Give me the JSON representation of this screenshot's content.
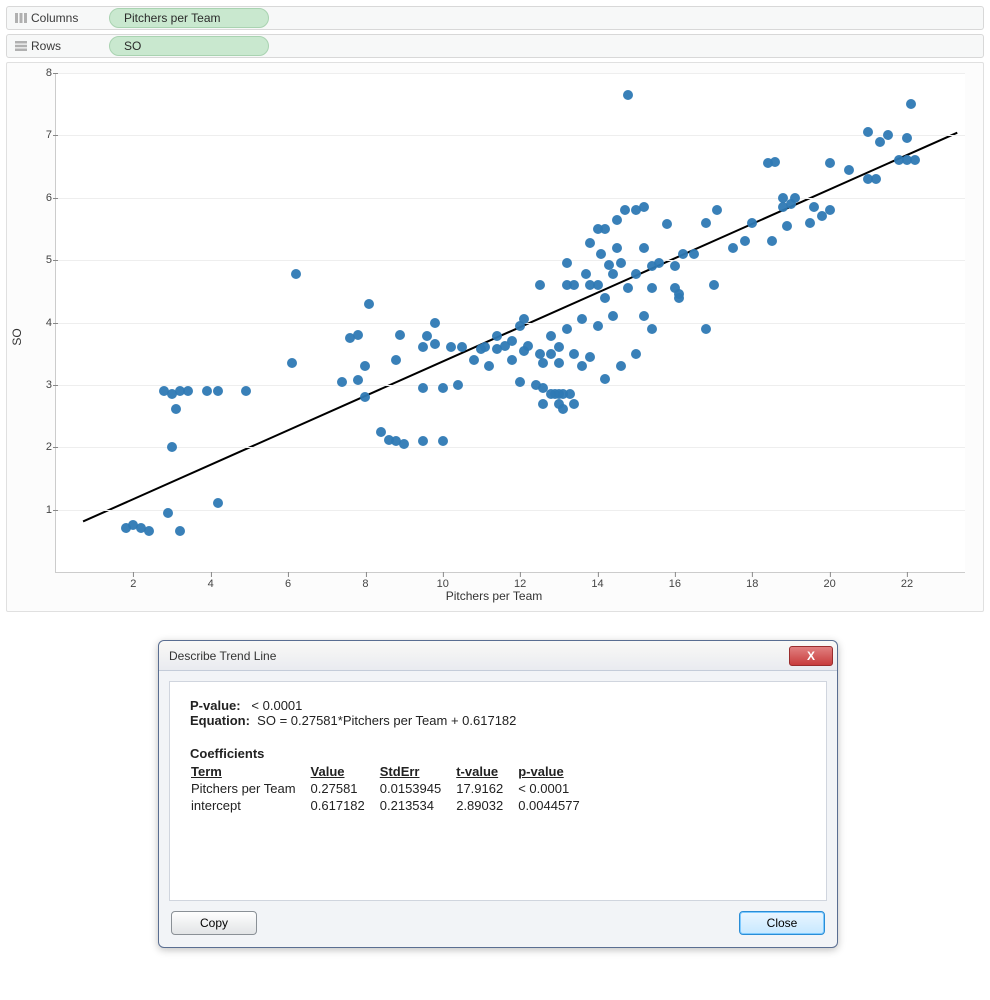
{
  "shelves": {
    "columns_label": "Columns",
    "rows_label": "Rows",
    "columns_pill": "Pitchers per Team",
    "rows_pill": "SO"
  },
  "chart_data": {
    "type": "scatter",
    "xlabel": "Pitchers per Team",
    "ylabel": "SO",
    "xlim": [
      0,
      23.5
    ],
    "ylim": [
      0,
      8
    ],
    "xticks": [
      2,
      4,
      6,
      8,
      10,
      12,
      14,
      16,
      18,
      20,
      22
    ],
    "yticks": [
      1,
      2,
      3,
      4,
      5,
      6,
      7,
      8
    ],
    "trend": {
      "slope": 0.27581,
      "intercept": 0.617182,
      "x0": 0.7,
      "x1": 23.3
    },
    "points": [
      [
        1.8,
        0.7
      ],
      [
        2.0,
        0.75
      ],
      [
        2.2,
        0.7
      ],
      [
        2.4,
        0.65
      ],
      [
        2.9,
        0.95
      ],
      [
        3.2,
        0.65
      ],
      [
        2.8,
        2.9
      ],
      [
        3.0,
        2.85
      ],
      [
        3.1,
        2.62
      ],
      [
        3.0,
        2.0
      ],
      [
        3.2,
        2.9
      ],
      [
        3.4,
        2.9
      ],
      [
        3.9,
        2.9
      ],
      [
        4.2,
        2.9
      ],
      [
        4.9,
        2.9
      ],
      [
        4.2,
        1.1
      ],
      [
        6.1,
        3.35
      ],
      [
        6.2,
        4.78
      ],
      [
        7.4,
        3.05
      ],
      [
        7.6,
        3.75
      ],
      [
        7.8,
        3.8
      ],
      [
        7.8,
        3.08
      ],
      [
        8.0,
        2.8
      ],
      [
        8.0,
        3.3
      ],
      [
        8.1,
        4.3
      ],
      [
        8.4,
        2.25
      ],
      [
        8.6,
        2.12
      ],
      [
        8.8,
        2.1
      ],
      [
        8.8,
        3.4
      ],
      [
        8.9,
        3.8
      ],
      [
        9.0,
        2.06
      ],
      [
        9.5,
        2.1
      ],
      [
        9.5,
        2.95
      ],
      [
        9.5,
        3.6
      ],
      [
        9.6,
        3.78
      ],
      [
        9.8,
        3.65
      ],
      [
        9.8,
        4.0
      ],
      [
        10.0,
        2.1
      ],
      [
        10.0,
        2.95
      ],
      [
        10.2,
        3.6
      ],
      [
        10.4,
        3.0
      ],
      [
        10.5,
        3.6
      ],
      [
        10.8,
        3.4
      ],
      [
        11.0,
        3.58
      ],
      [
        11.1,
        3.6
      ],
      [
        11.2,
        3.3
      ],
      [
        11.4,
        3.58
      ],
      [
        11.4,
        3.78
      ],
      [
        11.6,
        3.62
      ],
      [
        11.8,
        3.7
      ],
      [
        11.8,
        3.4
      ],
      [
        12.0,
        3.95
      ],
      [
        12.0,
        3.05
      ],
      [
        12.1,
        3.55
      ],
      [
        12.1,
        4.05
      ],
      [
        12.2,
        3.62
      ],
      [
        12.4,
        3.0
      ],
      [
        12.5,
        3.5
      ],
      [
        12.5,
        4.6
      ],
      [
        12.6,
        2.95
      ],
      [
        12.6,
        3.35
      ],
      [
        12.6,
        2.7
      ],
      [
        12.8,
        2.85
      ],
      [
        12.8,
        3.5
      ],
      [
        12.8,
        3.78
      ],
      [
        12.9,
        2.85
      ],
      [
        13.0,
        2.7
      ],
      [
        13.0,
        3.35
      ],
      [
        13.0,
        3.6
      ],
      [
        13.0,
        2.85
      ],
      [
        13.1,
        2.85
      ],
      [
        13.1,
        2.62
      ],
      [
        13.2,
        3.9
      ],
      [
        13.2,
        4.6
      ],
      [
        13.2,
        4.95
      ],
      [
        13.3,
        2.85
      ],
      [
        13.4,
        3.5
      ],
      [
        13.4,
        4.6
      ],
      [
        13.4,
        2.7
      ],
      [
        13.6,
        3.3
      ],
      [
        13.6,
        4.05
      ],
      [
        13.7,
        4.78
      ],
      [
        13.8,
        3.45
      ],
      [
        13.8,
        4.6
      ],
      [
        13.8,
        5.28
      ],
      [
        14.0,
        3.95
      ],
      [
        14.0,
        4.6
      ],
      [
        14.0,
        5.5
      ],
      [
        14.1,
        5.1
      ],
      [
        14.2,
        3.1
      ],
      [
        14.2,
        4.4
      ],
      [
        14.2,
        5.5
      ],
      [
        14.3,
        4.92
      ],
      [
        14.4,
        4.1
      ],
      [
        14.4,
        4.78
      ],
      [
        14.5,
        5.2
      ],
      [
        14.5,
        5.65
      ],
      [
        14.6,
        3.3
      ],
      [
        14.6,
        4.95
      ],
      [
        14.7,
        5.8
      ],
      [
        14.8,
        4.55
      ],
      [
        14.8,
        7.65
      ],
      [
        15.0,
        4.78
      ],
      [
        15.0,
        5.8
      ],
      [
        15.0,
        3.5
      ],
      [
        15.2,
        4.1
      ],
      [
        15.2,
        5.2
      ],
      [
        15.2,
        5.85
      ],
      [
        15.4,
        3.9
      ],
      [
        15.4,
        4.9
      ],
      [
        15.4,
        4.55
      ],
      [
        15.6,
        4.95
      ],
      [
        15.8,
        5.58
      ],
      [
        16.0,
        4.9
      ],
      [
        16.0,
        4.55
      ],
      [
        16.1,
        4.45
      ],
      [
        16.1,
        4.4
      ],
      [
        16.2,
        5.1
      ],
      [
        16.5,
        5.1
      ],
      [
        16.8,
        5.6
      ],
      [
        16.8,
        3.9
      ],
      [
        17.0,
        4.6
      ],
      [
        17.1,
        5.8
      ],
      [
        17.5,
        5.2
      ],
      [
        17.8,
        5.3
      ],
      [
        18.0,
        5.6
      ],
      [
        18.4,
        6.55
      ],
      [
        18.5,
        5.3
      ],
      [
        18.6,
        6.58
      ],
      [
        18.8,
        5.85
      ],
      [
        18.8,
        6.0
      ],
      [
        18.9,
        5.55
      ],
      [
        19.0,
        5.9
      ],
      [
        19.1,
        6.0
      ],
      [
        19.5,
        5.6
      ],
      [
        19.6,
        5.85
      ],
      [
        19.8,
        5.7
      ],
      [
        20.0,
        6.55
      ],
      [
        20.0,
        5.8
      ],
      [
        20.5,
        6.45
      ],
      [
        21.0,
        7.05
      ],
      [
        21.0,
        6.3
      ],
      [
        21.2,
        6.3
      ],
      [
        21.3,
        6.9
      ],
      [
        21.5,
        7.0
      ],
      [
        21.8,
        6.6
      ],
      [
        22.0,
        6.95
      ],
      [
        22.0,
        6.6
      ],
      [
        22.1,
        7.5
      ],
      [
        22.2,
        6.6
      ]
    ]
  },
  "dialog": {
    "title": "Describe Trend Line",
    "pvalue_label": "P-value:",
    "pvalue_value": "< 0.0001",
    "equation_label": "Equation:",
    "equation_value": "SO = 0.27581*Pitchers per Team + 0.617182",
    "coef_header": "Coefficients",
    "table": {
      "headers": [
        "Term",
        "Value",
        "StdErr",
        "t-value",
        "p-value"
      ],
      "rows": [
        {
          "term": "Pitchers per Team",
          "value": "0.27581",
          "stderr": "0.0153945",
          "tvalue": "17.9162",
          "pvalue": "< 0.0001"
        },
        {
          "term": "intercept",
          "value": "0.617182",
          "stderr": "0.213534",
          "tvalue": "2.89032",
          "pvalue": "0.0044577"
        }
      ]
    },
    "copy_label": "Copy",
    "close_label": "Close"
  }
}
